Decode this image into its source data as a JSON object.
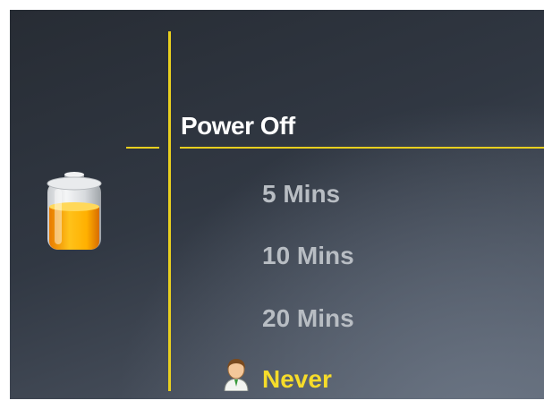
{
  "menu": {
    "title": "Power Off",
    "options": [
      {
        "label": "5 Mins",
        "selected": false
      },
      {
        "label": "10 Mins",
        "selected": false
      },
      {
        "label": "20 Mins",
        "selected": false
      },
      {
        "label": "Never",
        "selected": true
      }
    ]
  },
  "colors": {
    "accent": "#e8cf1f",
    "selected_text": "#f6dc2a",
    "option_text": "#b8bdc3",
    "title_text": "#ffffff",
    "background": "#313843"
  },
  "icons": {
    "battery": "battery-icon",
    "selection": "user-icon"
  }
}
